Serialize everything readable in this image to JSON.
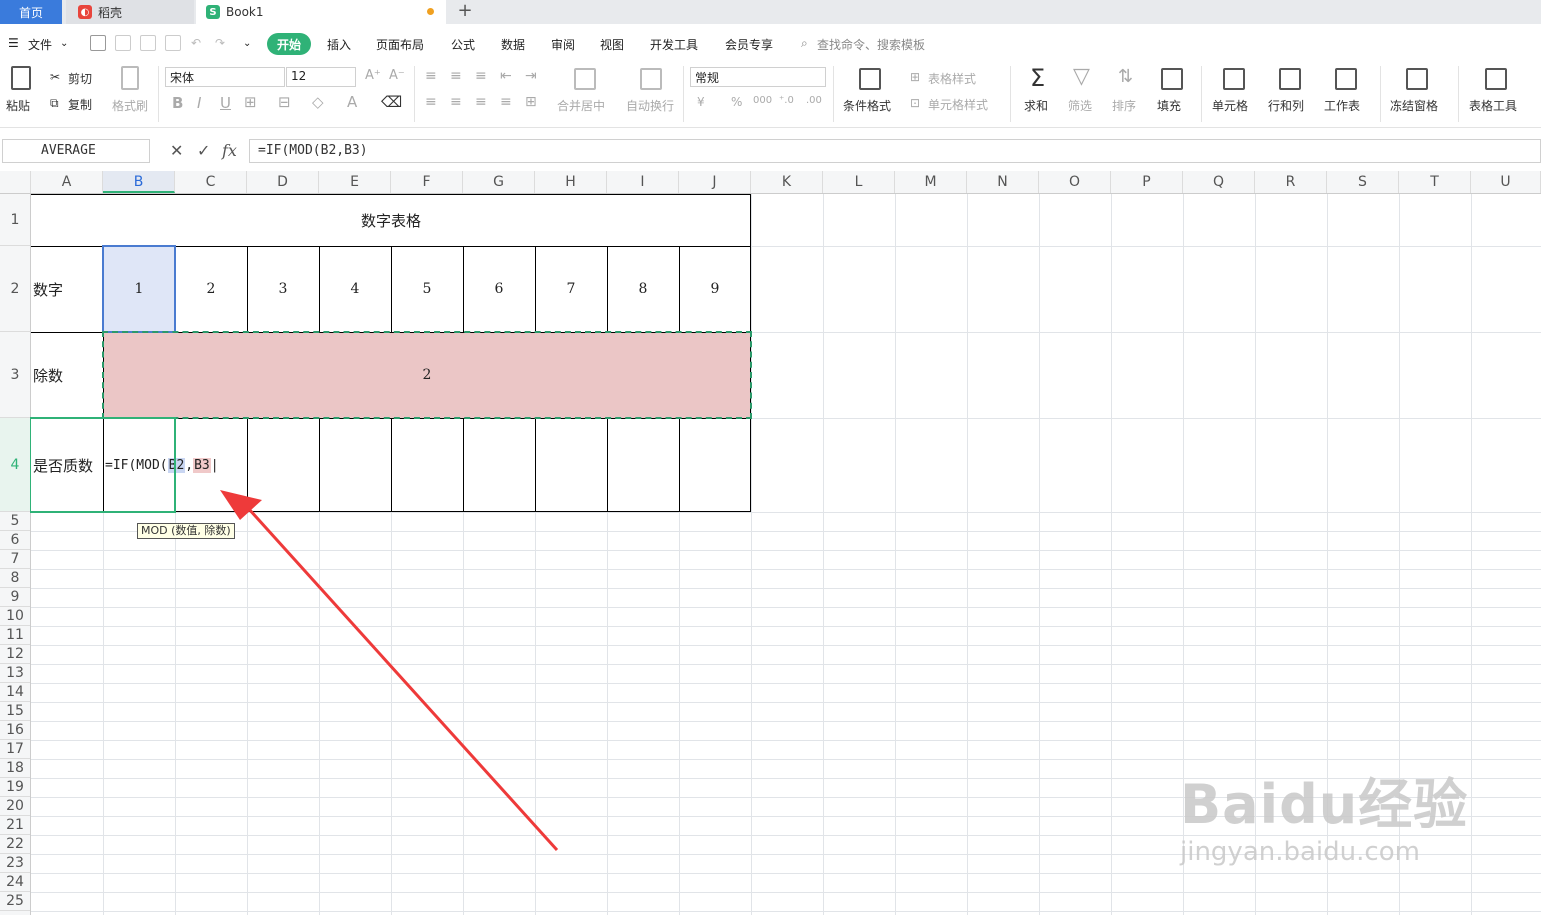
{
  "tabs": {
    "home": "首页",
    "daoke": "稻壳",
    "book": "Book1"
  },
  "menu": {
    "file": "文件",
    "start": "开始",
    "insert": "插入",
    "layout": "页面布局",
    "formula": "公式",
    "data": "数据",
    "review": "审阅",
    "view": "视图",
    "dev": "开发工具",
    "vip": "会员专享",
    "search": "查找命令、搜索模板"
  },
  "ribbon": {
    "paste": "粘贴",
    "cut": "剪切",
    "copy": "复制",
    "format_painter": "格式刷",
    "font": "宋体",
    "size": "12",
    "merge": "合并居中",
    "wrap": "自动换行",
    "numfmt": "常规",
    "cond": "条件格式",
    "table_style": "表格样式",
    "cell_style": "单元格样式",
    "sum": "求和",
    "filter": "筛选",
    "sort": "排序",
    "fill": "填充",
    "cell": "单元格",
    "rowcol": "行和列",
    "sheet": "工作表",
    "freeze": "冻结窗格",
    "tools": "表格工具"
  },
  "formula_bar": {
    "name_box": "AVERAGE",
    "formula": "=IF(MOD(B2,B3)"
  },
  "columns": [
    "A",
    "B",
    "C",
    "D",
    "E",
    "F",
    "G",
    "H",
    "I",
    "J",
    "K",
    "L",
    "M",
    "N",
    "O",
    "P",
    "Q",
    "R",
    "S",
    "T",
    "U"
  ],
  "rows": [
    "1",
    "2",
    "3",
    "4",
    "5",
    "6",
    "7",
    "8",
    "9",
    "10",
    "11",
    "12",
    "13",
    "14",
    "15",
    "16",
    "17",
    "18",
    "19",
    "20",
    "21",
    "22",
    "23",
    "24",
    "25"
  ],
  "sheet": {
    "title": "数字表格",
    "row2_label": "数字",
    "numbers": [
      "1",
      "2",
      "3",
      "4",
      "5",
      "6",
      "7",
      "8",
      "9"
    ],
    "row3_label": "除数",
    "divisor": "2",
    "row4_label": "是否质数",
    "edit_prefix": "=IF(MOD(",
    "edit_ref1": "B2",
    "edit_comma": ",",
    "edit_ref2": "B3",
    "tooltip": "MOD (数值, 除数)"
  },
  "watermark": {
    "brand": "Baidu经验",
    "url": "jingyan.baidu.com"
  },
  "colors": {
    "accent": "#2fb277",
    "selected": "#dfe6f7",
    "range": "#ebc6c6",
    "ref1": "#c9d6f2",
    "ref2": "#f0c9c9",
    "arrow": "#ee3a3a"
  }
}
